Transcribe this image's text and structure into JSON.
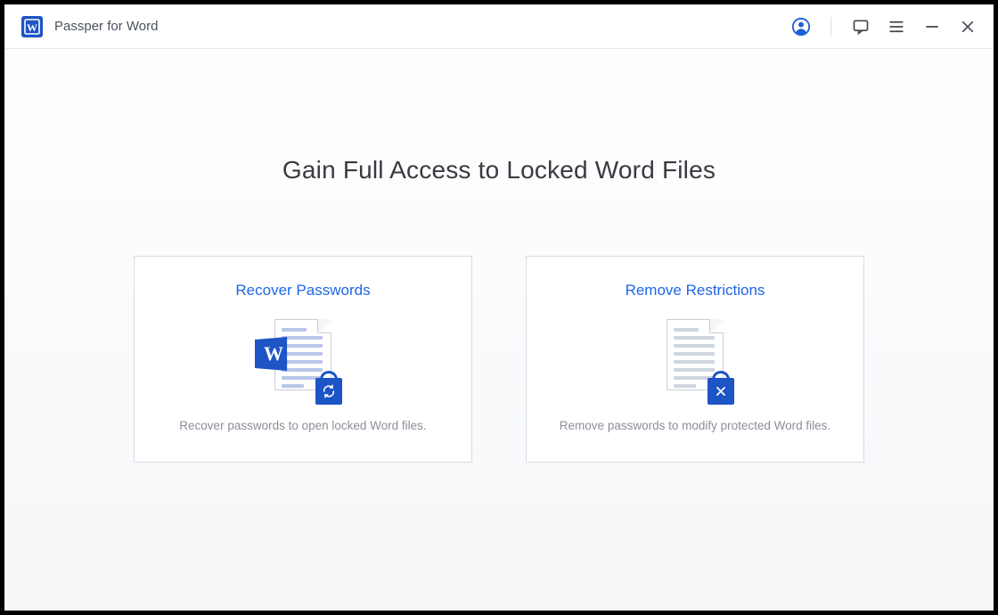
{
  "app": {
    "title": "Passper for Word"
  },
  "main": {
    "heading": "Gain Full Access to Locked Word Files",
    "cards": {
      "recover": {
        "title": "Recover Passwords",
        "desc": "Recover passwords to open locked Word files."
      },
      "remove": {
        "title": "Remove Restrictions",
        "desc": "Remove passwords to modify protected Word files."
      }
    }
  }
}
